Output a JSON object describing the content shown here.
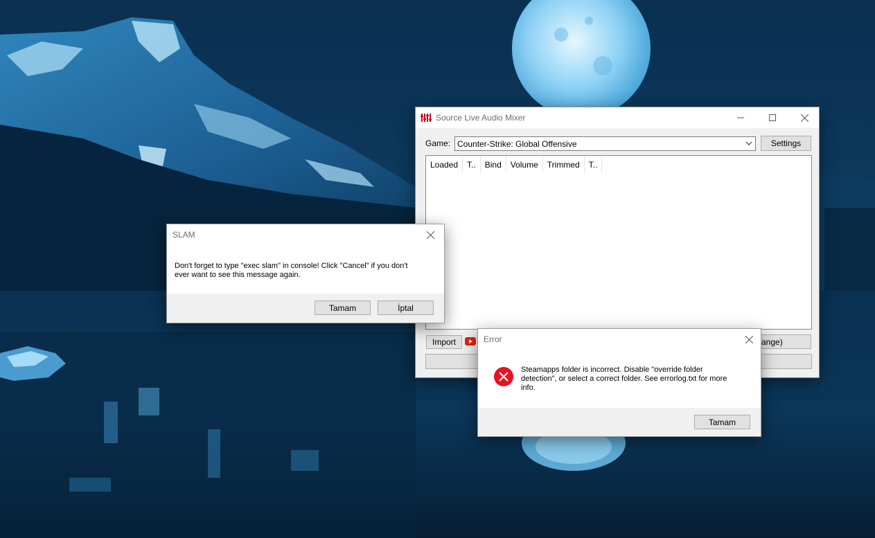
{
  "main_window": {
    "title": "Source Live Audio Mixer",
    "game_label": "Game:",
    "game_value": "Counter-Strike: Global Offensive",
    "settings_label": "Settings",
    "columns": [
      "Loaded",
      "T..",
      "Bind",
      "Volume",
      "Trimmed",
      "T.."
    ],
    "import_label": "Import",
    "partial_button_label": "ange)",
    "caption_buttons": {
      "minimize": "minimize-icon",
      "maximize": "maximize-icon",
      "close": "close-icon"
    }
  },
  "slam_dialog": {
    "title": "SLAM",
    "message_line1": "Don't forget to type \"exec slam\" in console! Click \"Cancel\" if you don't",
    "message_line2": "ever want to see this message again.",
    "ok_label": "Tamam",
    "cancel_label": "İptal"
  },
  "error_dialog": {
    "title": "Error",
    "icon": "error-icon",
    "message_line1": "Steamapps folder is incorrect. Disable \"override folder",
    "message_line2": "detection\", or select a correct folder. See errorlog.txt for more",
    "message_line3": "info.",
    "ok_label": "Tamam"
  },
  "colors": {
    "error_red": "#e81123",
    "youtube_red": "#e62117",
    "app_icon_red": "#d0021b",
    "window_bg": "#f0f0f0"
  }
}
